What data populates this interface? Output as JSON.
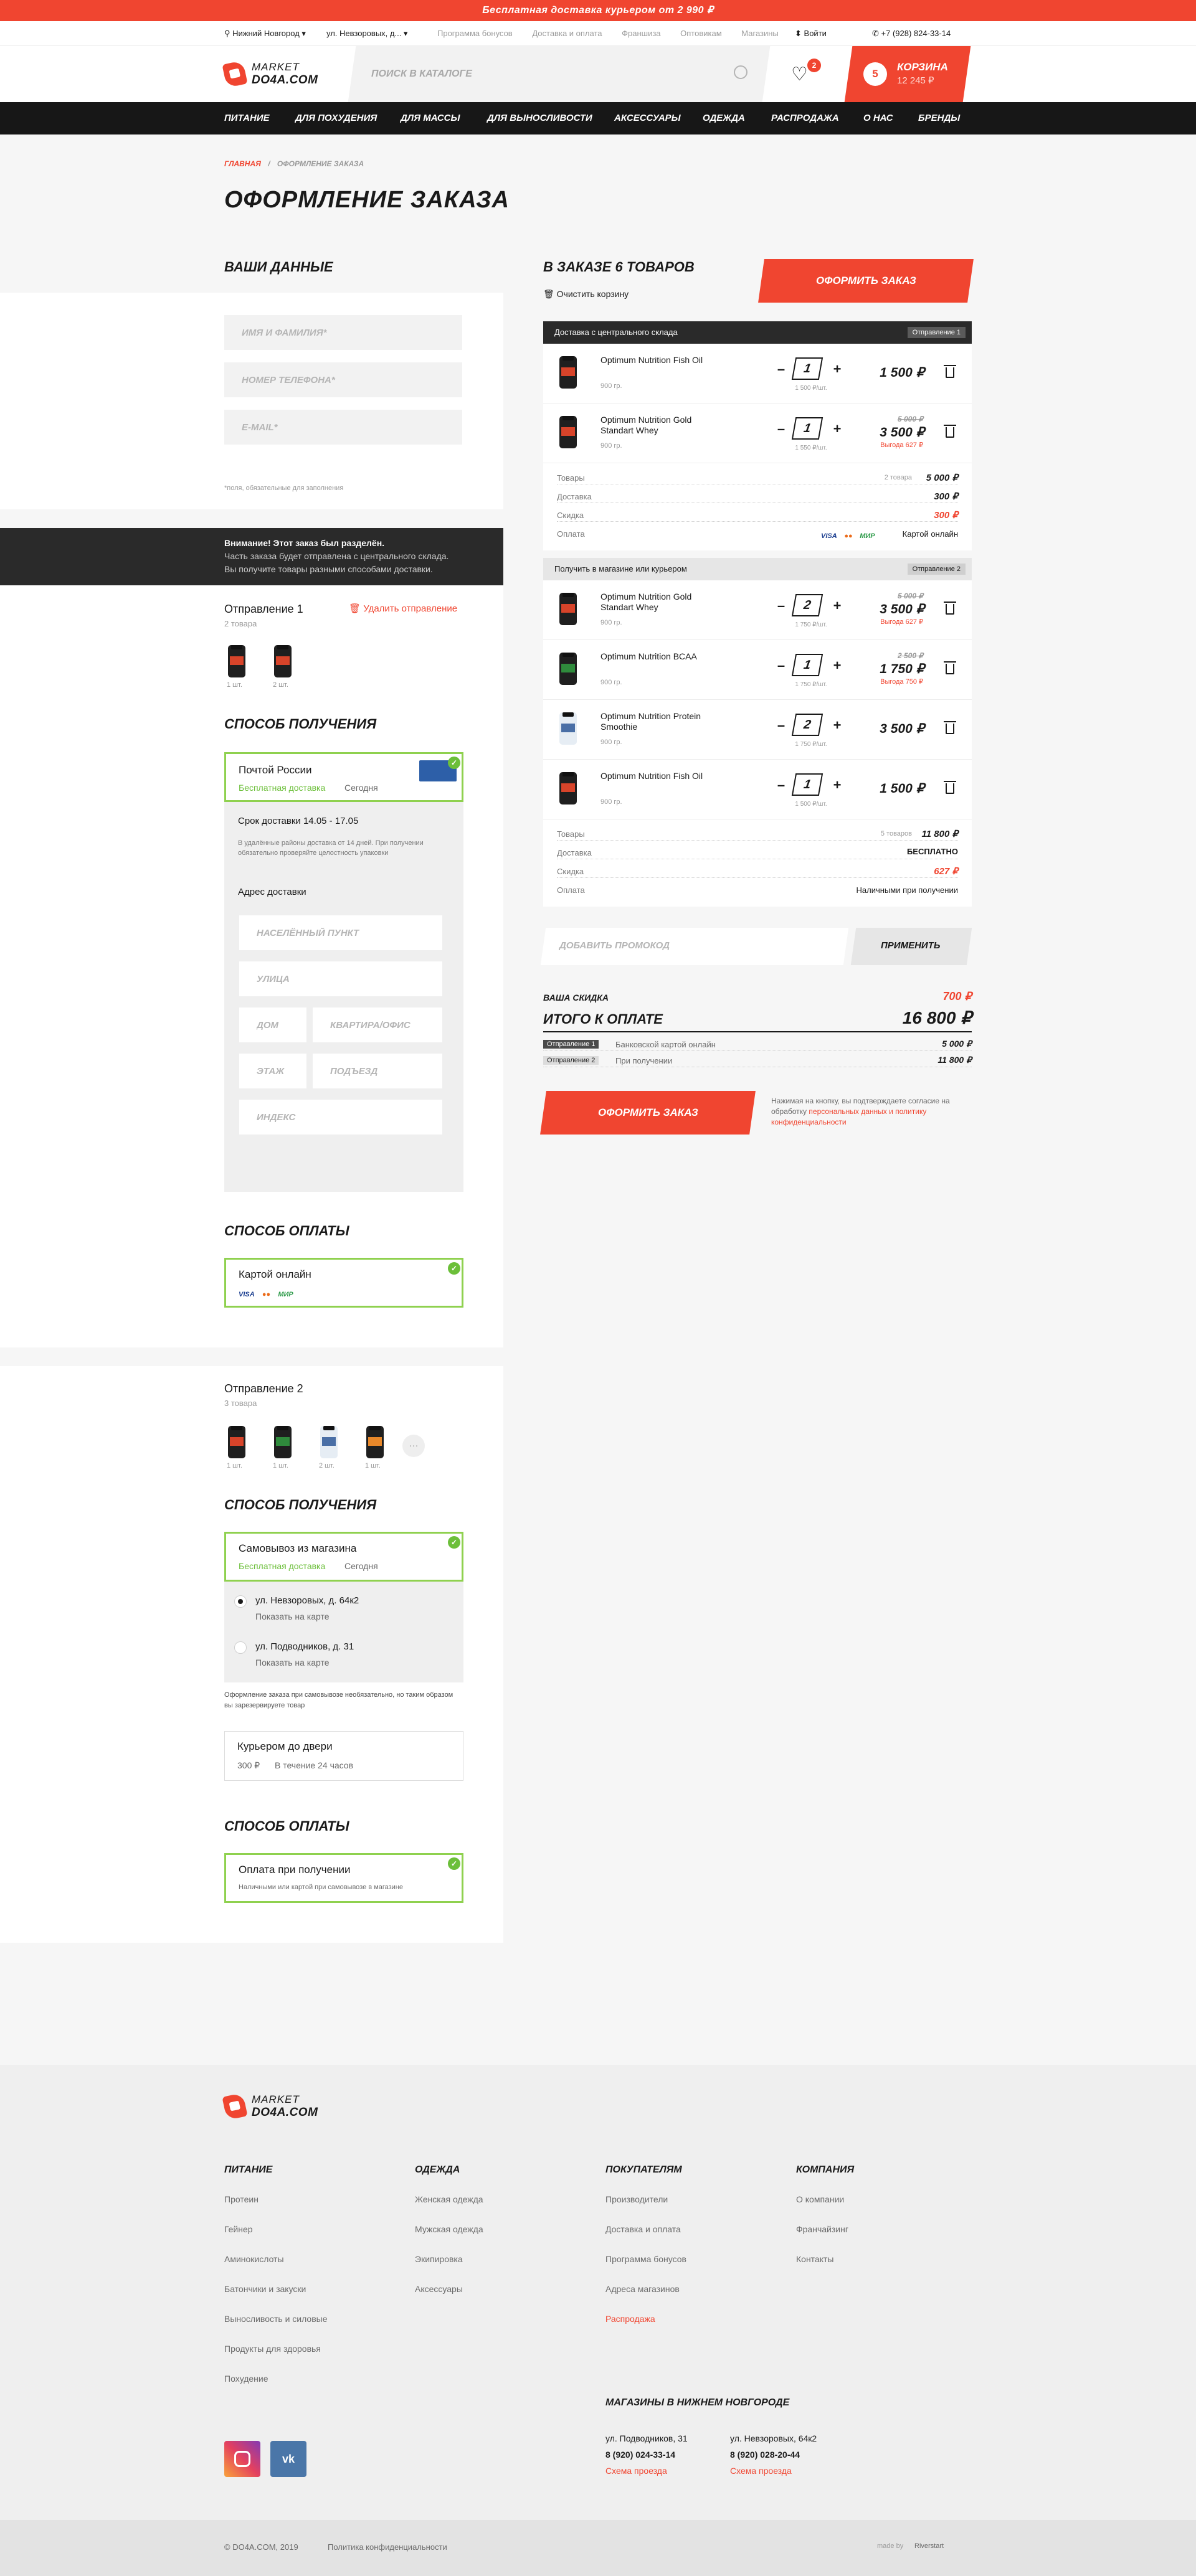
{
  "promo": "Бесплатная доставка курьером от 2 990 ₽",
  "topbar": {
    "city": "Нижний Новгород",
    "address": "ул. Невзоровых, д...",
    "links": [
      "Программа бонусов",
      "Доставка и оплата",
      "Франшиза",
      "Оптовикам",
      "Магазины"
    ],
    "login": "Войти",
    "phone": "+7 (928) 824-33-14"
  },
  "logo": {
    "line1": "MARKET",
    "line2": "DO4A.COM"
  },
  "search": {
    "placeholder": "ПОИСК В КАТАЛОГЕ"
  },
  "favorites": {
    "count": "2"
  },
  "cart": {
    "count": "5",
    "label": "Корзина",
    "sum": "12 245 ₽"
  },
  "nav": [
    "ПИТАНИЕ",
    "ДЛЯ ПОХУДЕНИЯ",
    "ДЛЯ МАССЫ",
    "ДЛЯ ВЫНОСЛИВОСТИ",
    "АКСЕССУАРЫ",
    "ОДЕЖДА",
    "РАСПРОДАЖА",
    "О НАС",
    "БРЕНДЫ"
  ],
  "breadcrumb": {
    "home": "ГЛАВНАЯ",
    "sep": "/",
    "current": "ОФОРМЛЕНИЕ ЗАКАЗА"
  },
  "title": "ОФОРМЛЕНИЕ ЗАКАЗА",
  "your_data": {
    "heading": "ВАШИ ДАННЫЕ",
    "name_placeholder": "ИМЯ И ФАМИЛИЯ*",
    "phone_placeholder": "НОМЕР ТЕЛЕФОНА*",
    "email_placeholder": "E-MAIL*",
    "required_note": "*поля, обязательные для заполнения"
  },
  "notice": {
    "line1": "Внимание! Этот заказ был разделён.",
    "line2": "Часть заказа будет отправлена с центрального склада.",
    "line3": "Вы получите товары разными способами доставки."
  },
  "shipment1": {
    "title": "Отправление 1",
    "count": "2 товара",
    "delete": "Удалить отправление",
    "items": [
      {
        "qty": "1 шт."
      },
      {
        "qty": "2 шт."
      }
    ],
    "delivery_heading": "СПОСОБ ПОЛУЧЕНИЯ",
    "delivery_option": "Почтой России",
    "delivery_free": "Бесплатная доставка",
    "delivery_when": "Сегодня",
    "delivery_term": "Срок доставки 14.05 - 17.05",
    "delivery_note": "В удалённые районы доставка от 14 дней. При получении обязательно проверяйте целостность упаковки",
    "address_title": "Адрес доставки",
    "fields": [
      "НАСЕЛЁННЫЙ ПУНКТ",
      "УЛИЦА",
      "ДОМ",
      "КВАРТИРА/ОФИС",
      "ЭТАЖ",
      "ПОДЪЕЗД",
      "ИНДЕКС"
    ],
    "payment_heading": "СПОСОБ ОПЛАТЫ",
    "payment_option": "Картой онлайн",
    "payment_logos": [
      "VISA",
      "●●",
      "МИР"
    ]
  },
  "shipment2": {
    "title": "Отправление 2",
    "count": "3 товара",
    "items": [
      {
        "qty": "1 шт."
      },
      {
        "qty": "1 шт."
      },
      {
        "qty": "2 шт."
      },
      {
        "qty": "1 шт."
      }
    ],
    "more": "···",
    "delivery_heading": "СПОСОБ ПОЛУЧЕНИЯ",
    "delivery_option": "Самовывоз из магазина",
    "delivery_free": "Бесплатная доставка",
    "delivery_when": "Сегодня",
    "stores": [
      {
        "address": "ул. Невзоровых, д. 64к2",
        "map": "Показать на карте"
      },
      {
        "address": "ул. Подводников, д. 31",
        "map": "Показать на карте"
      }
    ],
    "pickup_note": "Оформление заказа при самовывозе необязательно, но таким образом вы зарезервируете товар",
    "courier": "Курьером до двери",
    "courier_price": "300 ₽",
    "courier_time": "В течение 24 часов",
    "payment_heading": "СПОСОБ ОПЛАТЫ",
    "payment_option": "Оплата при получении",
    "payment_note": "Наличными или картой при самовывозе в магазине"
  },
  "order": {
    "heading": "В ЗАКАЗЕ 6 ТОВАРОВ",
    "clear": "Очистить корзину",
    "submit": "ОФОРМИТЬ ЗАКАЗ",
    "group1": {
      "title": "Доставка с центрального склада",
      "tag": "Отправление 1",
      "items": [
        {
          "name": "Optimum Nutrition Fish Oil",
          "weight": "900 гр.",
          "qty": "1",
          "unit": "1 500 ₽/шт.",
          "price": "1 500 ₽",
          "old": "",
          "save": ""
        },
        {
          "name": "Optimum Nutrition Gold Standart Whey",
          "weight": "900 гр.",
          "qty": "1",
          "unit": "1 550 ₽/шт.",
          "price": "3 500 ₽",
          "old": "5 000 ₽",
          "save": "Выгода 627 ₽"
        }
      ],
      "summary": {
        "goods_label": "Товары",
        "goods_count": "2 товара",
        "goods": "5 000 ₽",
        "delivery_label": "Доставка",
        "delivery": "300 ₽",
        "discount_label": "Скидка",
        "discount": "300 ₽",
        "payment_label": "Оплата",
        "payment": "Картой онлайн"
      }
    },
    "group2": {
      "title": "Получить в магазине или курьером",
      "tag": "Отправление 2",
      "items": [
        {
          "name": "Optimum Nutrition Gold Standart Whey",
          "weight": "900 гр.",
          "qty": "2",
          "unit": "1 750 ₽/шт.",
          "price": "3 500 ₽",
          "old": "5 000 ₽",
          "save": "Выгода 627 ₽"
        },
        {
          "name": "Optimum Nutrition BCAA",
          "weight": "900 гр.",
          "qty": "1",
          "unit": "1 750 ₽/шт.",
          "price": "1 750 ₽",
          "old": "2 500 ₽",
          "save": "Выгода 750 ₽"
        },
        {
          "name": "Optimum Nutrition Protein Smoothie",
          "weight": "900 гр.",
          "qty": "2",
          "unit": "1 750 ₽/шт.",
          "price": "3 500 ₽",
          "old": "",
          "save": ""
        },
        {
          "name": "Optimum Nutrition Fish Oil",
          "weight": "900 гр.",
          "qty": "1",
          "unit": "1 500 ₽/шт.",
          "price": "1 500 ₽",
          "old": "",
          "save": ""
        }
      ],
      "summary": {
        "goods_label": "Товары",
        "goods_count": "5 товаров",
        "goods": "11 800 ₽",
        "delivery_label": "Доставка",
        "delivery": "БЕСПЛАТНО",
        "discount_label": "Скидка",
        "discount": "627 ₽",
        "payment_label": "Оплата",
        "payment": "Наличными при получении"
      }
    },
    "promo_placeholder": "ДОБАВИТЬ ПРОМОКОД",
    "promo_apply": "ПРИМЕНИТЬ",
    "discount_label": "ВАША СКИДКА",
    "discount_value": "700 ₽",
    "total_label": "ИТОГО К ОПЛАТЕ",
    "total_value": "16 800 ₽",
    "parts": [
      {
        "tag": "Отправление 1",
        "method": "Банковской картой онлайн",
        "sum": "5 000 ₽"
      },
      {
        "tag": "Отправление 2",
        "method": "При получении",
        "sum": "11 800 ₽"
      }
    ],
    "consent_text": "Нажимая на кнопку, вы подтверждаете согласие на обработку ",
    "consent_link": "персональных данных и политику конфиденциальности"
  },
  "footer": {
    "columns": [
      {
        "title": "ПИТАНИЕ",
        "items": [
          "Протеин",
          "Гейнер",
          "Аминокислоты",
          "Батончики и закуски",
          "Выносливость и силовые",
          "Продукты для здоровья",
          "Похудение"
        ]
      },
      {
        "title": "ОДЕЖДА",
        "items": [
          "Женская одежда",
          "Мужская одежда",
          "Экипировка",
          "Аксессуары"
        ]
      },
      {
        "title": "ПОКУПАТЕЛЯМ",
        "items": [
          "Производители",
          "Доставка и оплата",
          "Программа бонусов",
          "Адреса магазинов",
          "Распродажа"
        ]
      },
      {
        "title": "КОМПАНИЯ",
        "items": [
          "О компании",
          "Франчайзинг",
          "Контакты"
        ]
      }
    ],
    "stores_title": "МАГАЗИНЫ В НИЖНЕМ НОВГОРОДЕ",
    "stores": [
      {
        "address": "ул. Подводников, 31",
        "phone": "8 (920) 024-33-14",
        "scheme": "Схема проезда"
      },
      {
        "address": "ул. Невзоровых, 64к2",
        "phone": "8 (920) 028-20-44",
        "scheme": "Схема проезда"
      }
    ],
    "copyright": "© DO4A.COM, 2019",
    "privacy": "Политика конфиденциальности",
    "made_by": "made by",
    "studio": "Riverstart"
  },
  "colors": {
    "accent": "#f04530",
    "dark": "#171717",
    "success": "#8fd14f"
  }
}
